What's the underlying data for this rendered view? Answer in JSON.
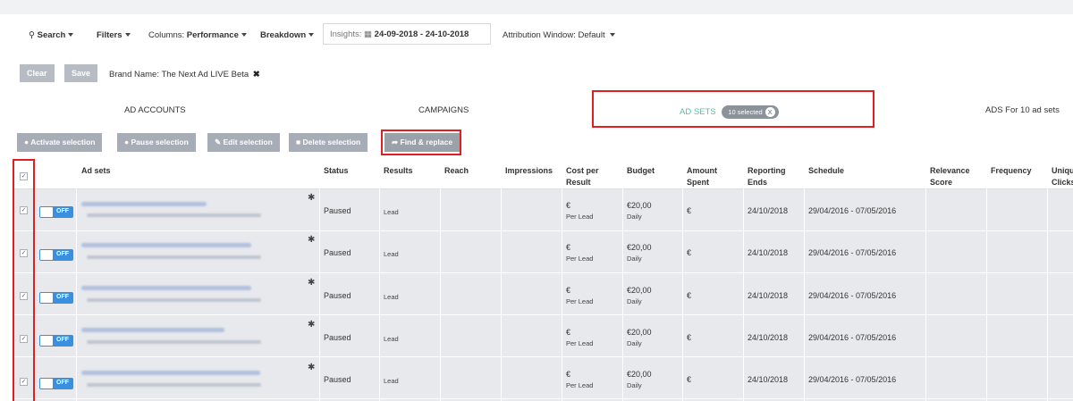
{
  "toolbar": {
    "search": "Search",
    "filters": "Filters",
    "columns_prefix": "Columns:",
    "columns_value": "Performance",
    "breakdown": "Breakdown",
    "insights_label": "Insights:",
    "date_from": "24-09-2018",
    "date_sep": "-",
    "date_to": "24-10-2018",
    "attribution_label": "Attribution Window:",
    "attribution_value": "Default"
  },
  "filters": {
    "clear": "Clear",
    "save": "Save",
    "brand_label": "Brand Name:",
    "brand_value": "The Next Ad LIVE Beta",
    "brand_remove": "✖"
  },
  "levels": {
    "ad_accounts": "AD ACCOUNTS",
    "campaigns": "CAMPAIGNS",
    "ad_sets": "AD SETS",
    "selected": "10 selected",
    "selected_clear": "X",
    "ads": "ADS For 10 ad sets"
  },
  "actions": {
    "activate": "Activate selection",
    "pause": "Pause selection",
    "edit": "Edit selection",
    "delete": "Delete selection",
    "find": "Find & replace"
  },
  "table": {
    "columns": {
      "adsets": "Ad sets",
      "status": "Status",
      "results": "Results",
      "reach": "Reach",
      "impressions": "Impressions",
      "cost1": "Cost per",
      "cost2": "Result",
      "budget": "Budget",
      "amount1": "Amount",
      "amount2": "Spent",
      "reporting1": "Reporting",
      "reporting2": "Ends",
      "schedule": "Schedule",
      "relevance1": "Relevance",
      "relevance2": "Score",
      "frequency": "Frequency",
      "unique1": "Uniqu",
      "unique2": "Clicks"
    },
    "rows": [
      {
        "toggle": "OFF",
        "status": "Paused",
        "results": "Lead",
        "cost": "€",
        "cost_unit": "Per Lead",
        "budget": "€20,00",
        "budget_unit": "Daily",
        "spent": "€",
        "ends": "24/10/2018",
        "schedule": "29/04/2016 - 07/05/2016"
      },
      {
        "toggle": "OFF",
        "status": "Paused",
        "results": "Lead",
        "cost": "€",
        "cost_unit": "Per Lead",
        "budget": "€20,00",
        "budget_unit": "Daily",
        "spent": "€",
        "ends": "24/10/2018",
        "schedule": "29/04/2016 - 07/05/2016"
      },
      {
        "toggle": "OFF",
        "status": "Paused",
        "results": "Lead",
        "cost": "€",
        "cost_unit": "Per Lead",
        "budget": "€20,00",
        "budget_unit": "Daily",
        "spent": "€",
        "ends": "24/10/2018",
        "schedule": "29/04/2016 - 07/05/2016"
      },
      {
        "toggle": "OFF",
        "status": "Paused",
        "results": "Lead",
        "cost": "€",
        "cost_unit": "Per Lead",
        "budget": "€20,00",
        "budget_unit": "Daily",
        "spent": "€",
        "ends": "24/10/2018",
        "schedule": "29/04/2016 - 07/05/2016"
      },
      {
        "toggle": "OFF",
        "status": "Paused",
        "results": "Lead",
        "cost": "€",
        "cost_unit": "Per Lead",
        "budget": "€20,00",
        "budget_unit": "Daily",
        "spent": "€",
        "ends": "24/10/2018",
        "schedule": "29/04/2016 - 07/05/2016"
      }
    ]
  }
}
